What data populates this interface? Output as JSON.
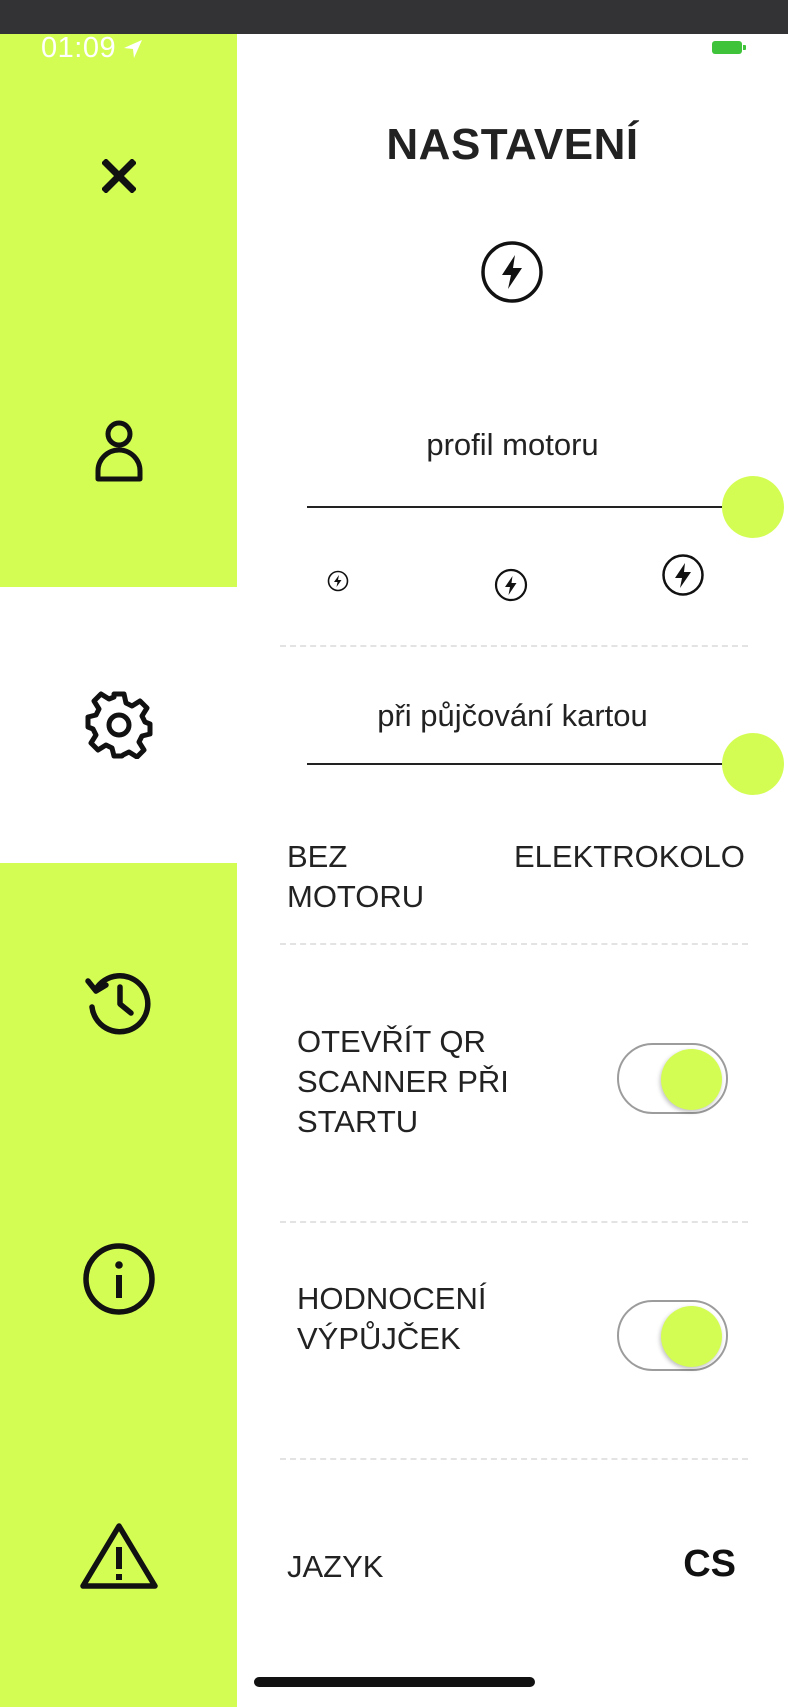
{
  "status_bar": {
    "time": "01:09",
    "location_icon": "location-arrow-icon",
    "battery_icon": "battery-charging-icon"
  },
  "sidebar": {
    "items": [
      {
        "name": "close",
        "icon": "close-icon"
      },
      {
        "name": "profile",
        "icon": "user-icon"
      },
      {
        "name": "settings",
        "icon": "gear-icon",
        "active": true
      },
      {
        "name": "history",
        "icon": "history-icon"
      },
      {
        "name": "info",
        "icon": "info-icon"
      },
      {
        "name": "report",
        "icon": "warning-icon"
      }
    ],
    "accent_color": "#d4fd54"
  },
  "settings": {
    "title": "NASTAVENÍ",
    "header_icon": "lightning-icon",
    "motor_profile": {
      "label": "profil motoru",
      "level": 1.0,
      "options": [
        "low-power-icon",
        "medium-power-icon",
        "high-power-icon"
      ]
    },
    "card_rental": {
      "label": "při půjčování kartou",
      "level": 1.0,
      "left_option": "BEZ MOTORU",
      "right_option": "ELEKTROKOLO"
    },
    "qr_scanner": {
      "label": "OTEVŘÍT QR SCANNER PŘI STARTU",
      "enabled": true
    },
    "rental_rating": {
      "label": "HODNOCENÍ VÝPŮJČEK",
      "enabled": true
    },
    "language": {
      "label": "JAZYK",
      "value": "CS"
    }
  }
}
